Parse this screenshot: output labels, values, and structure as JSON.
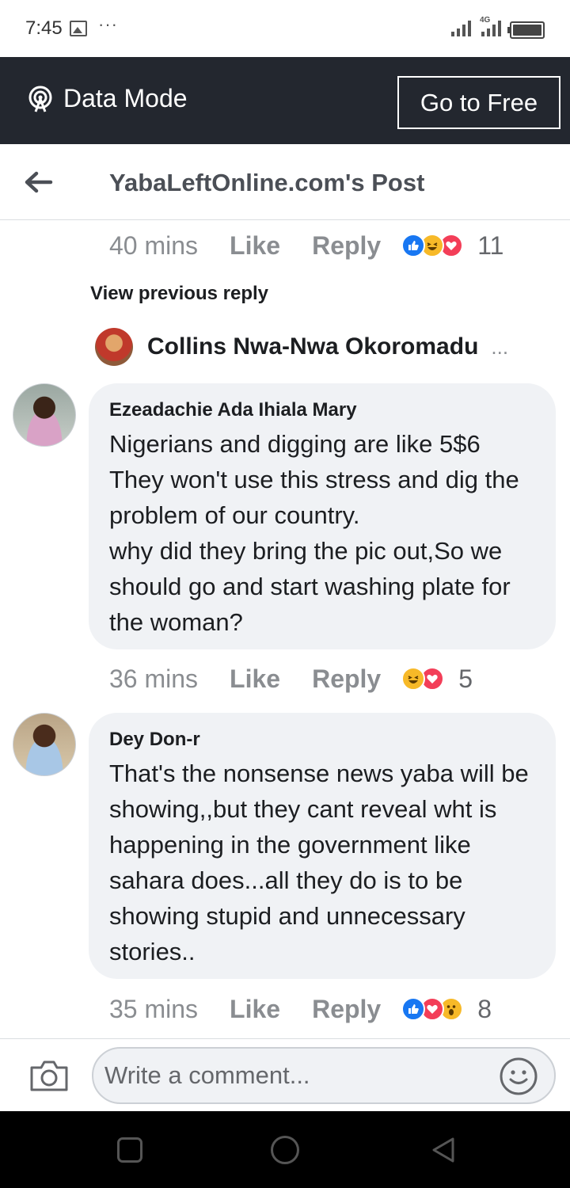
{
  "status_bar": {
    "time": "7:45",
    "network_type": "4G"
  },
  "data_bar": {
    "label": "Data Mode",
    "button": "Go to Free"
  },
  "header": {
    "title": "YabaLeftOnline.com's Post"
  },
  "top_meta": {
    "time": "40 mins",
    "like": "Like",
    "reply": "Reply",
    "reaction_count": "11"
  },
  "view_previous": "View previous reply",
  "reply_preview": {
    "name": "Collins Nwa-Nwa Okoromadu",
    "more": "..."
  },
  "comments": [
    {
      "author": "Ezeadachie Ada Ihiala Mary",
      "text": "Nigerians and digging are like 5$6\nThey won't use this stress and dig the problem of our country.\nwhy did they bring the pic out,So we should go and start washing plate for the woman?",
      "time": "36 mins",
      "like": "Like",
      "reply": "Reply",
      "reaction_count": "5"
    },
    {
      "author": "Dey Don-r",
      "text": "That's the nonsense news  yaba will be showing,,but they cant reveal wht is happening in the government like sahara does...all they do is to be showing stupid and unnecessary stories..",
      "time": "35 mins",
      "like": "Like",
      "reply": "Reply",
      "reaction_count": "8"
    }
  ],
  "composer": {
    "placeholder": "Write a comment..."
  },
  "colors": {
    "data_bar_bg": "#23272f",
    "bubble_bg": "#f0f2f5",
    "like_blue": "#1877f2",
    "haha_yellow": "#f7b928",
    "love_red": "#f33e58"
  }
}
